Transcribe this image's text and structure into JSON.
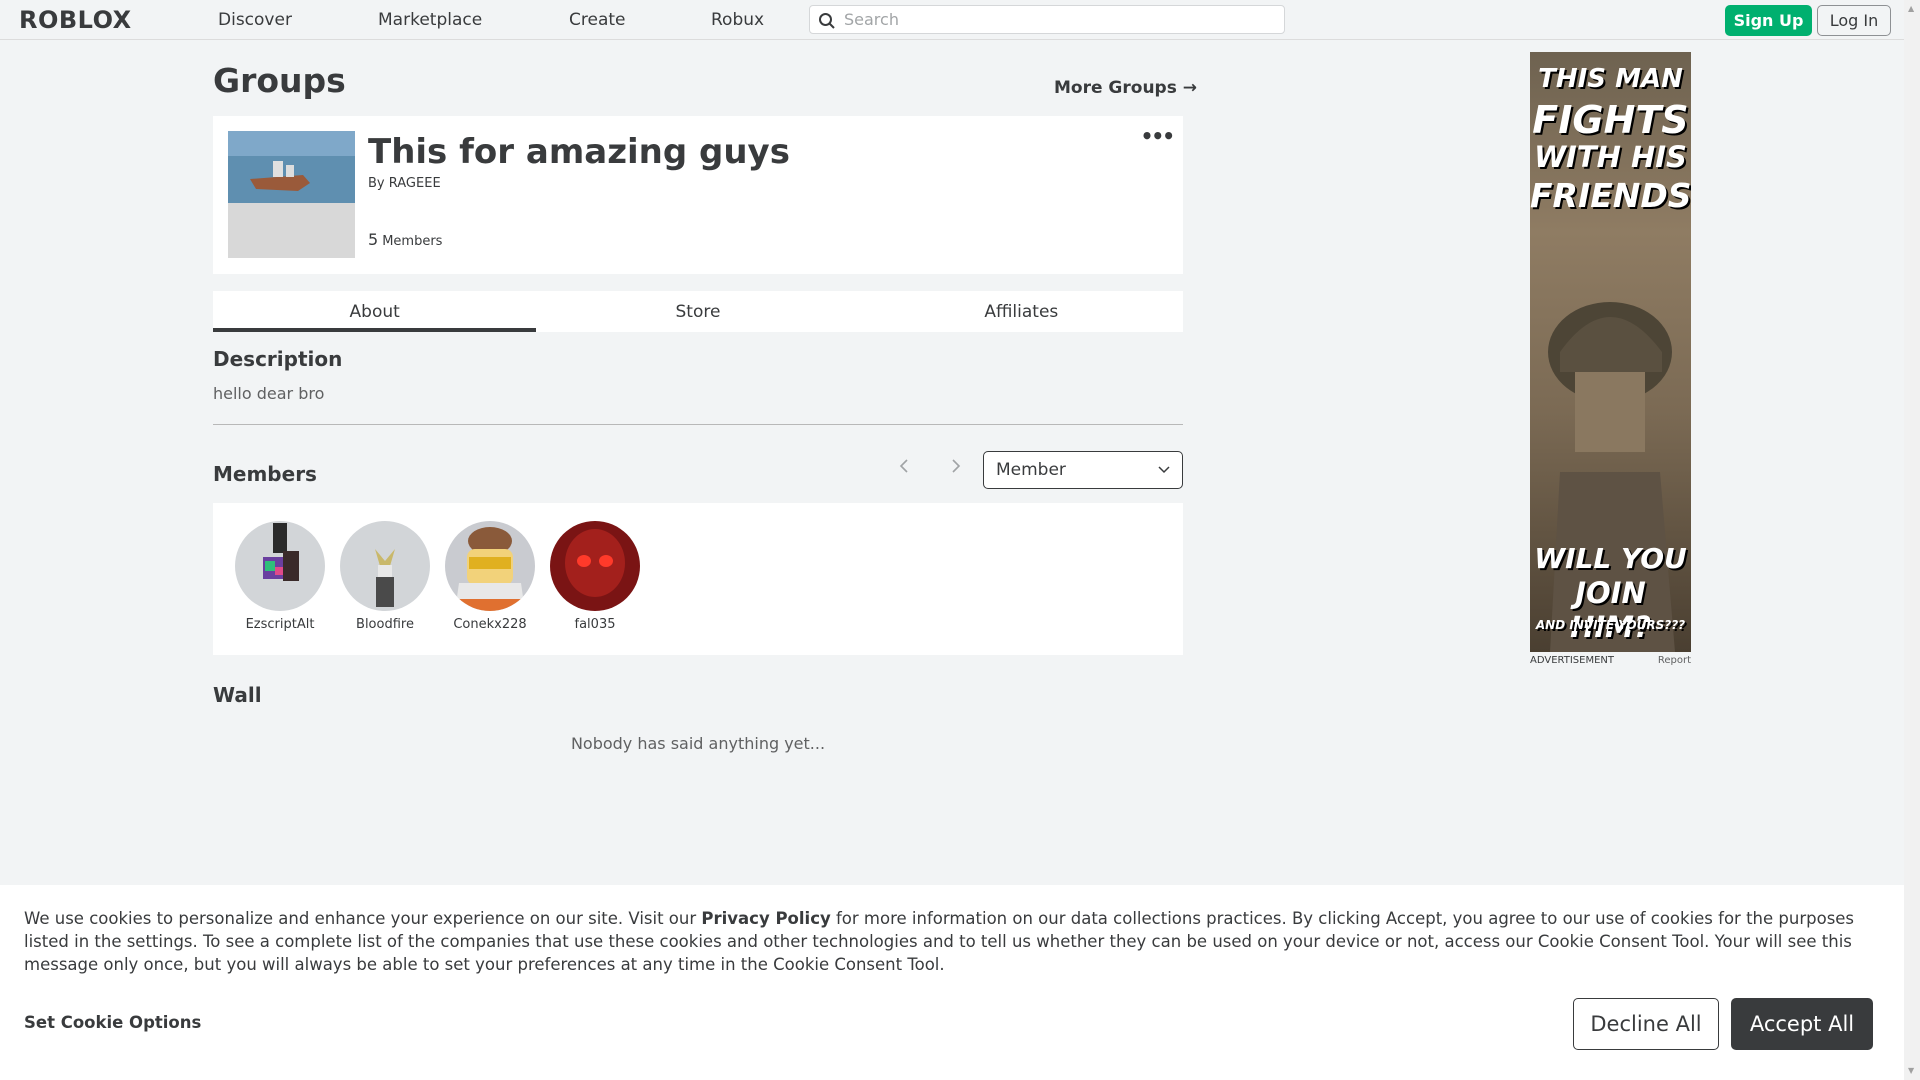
{
  "nav": {
    "logo": "ROBLOX",
    "links": [
      "Discover",
      "Marketplace",
      "Create",
      "Robux"
    ],
    "search_placeholder": "Search",
    "signup": "Sign Up",
    "login": "Log In"
  },
  "page": {
    "title": "Groups",
    "more_groups": "More Groups →"
  },
  "group": {
    "name": "This for amazing guys",
    "by_prefix": "By",
    "owner": "RAGEEE",
    "member_count": "5",
    "member_label": "Members",
    "more_icon": "•••"
  },
  "tabs": [
    "About",
    "Store",
    "Affiliates"
  ],
  "about": {
    "description_title": "Description",
    "description": "hello dear bro",
    "members_title": "Members",
    "role_select": "Member",
    "members": [
      {
        "name": "EzscriptAlt"
      },
      {
        "name": "Bloodfire"
      },
      {
        "name": "Conekx228"
      },
      {
        "name": "fal035"
      }
    ],
    "wall_title": "Wall",
    "wall_empty": "Nobody has said anything yet..."
  },
  "ad": {
    "line1": "THIS MAN",
    "line2": "FIGHTS",
    "line3": "WITH HIS",
    "line4": "FRIENDS",
    "line5": "WILL YOU",
    "line6": "JOIN HIM?",
    "line7": "AND INVITE YOURS???",
    "label": "ADVERTISEMENT",
    "report": "Report"
  },
  "cookies": {
    "text_before": "We use cookies to personalize and enhance your experience on our site. Visit our ",
    "privacy_link": "Privacy Policy",
    "text_after": " for more information on our data collections practices. By clicking Accept, you agree to our use of cookies for the purposes listed in the settings. To see a complete list of the companies that use these cookies and other technologies and to tell us whether they can be used on your device or not, access our Cookie Consent Tool. Your will see this message only once, but you will always be able to set your preferences at any time in the Cookie Consent Tool.",
    "set_options": "Set Cookie Options",
    "decline": "Decline All",
    "accept": "Accept All"
  },
  "colors": {
    "accent_green": "#00b06f",
    "text_dark": "#393b3d",
    "background": "#f2f4f5"
  }
}
